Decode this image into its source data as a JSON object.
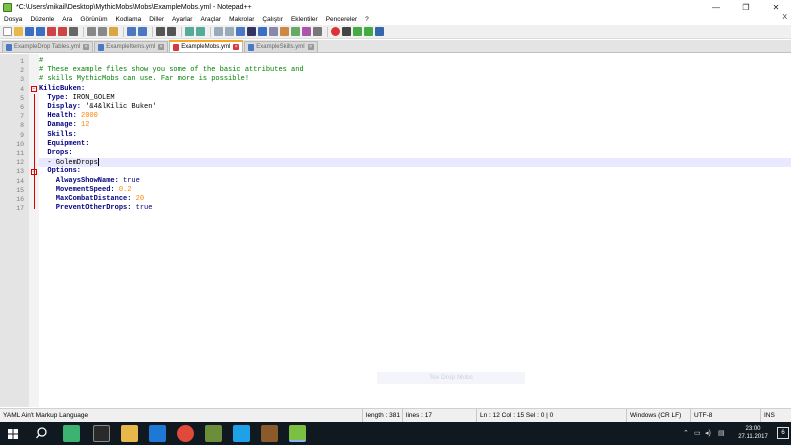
{
  "window": {
    "title": "*C:\\Users\\mikail\\Desktop\\MythicMobs\\Mobs\\ExampleMobs.yml - Notepad++",
    "minimize": "—",
    "maximize": "❐",
    "close": "✕"
  },
  "menu": {
    "items": [
      "Dosya",
      "Düzenle",
      "Ara",
      "Görünüm",
      "Kodlama",
      "Diller",
      "Ayarlar",
      "Araçlar",
      "Makrolar",
      "Çalıştır",
      "Eklentiler",
      "Pencereler",
      "?"
    ],
    "close_label": "X"
  },
  "tabs": [
    {
      "label": "ExampleDrop Tables.yml",
      "active": false
    },
    {
      "label": "ExampleItems.yml",
      "active": false
    },
    {
      "label": "ExampleMobs.yml",
      "active": true
    },
    {
      "label": "ExampleSkills.yml",
      "active": false
    }
  ],
  "editor": {
    "line_numbers": [
      "1",
      "2",
      "3",
      "4",
      "5",
      "6",
      "7",
      "8",
      "9",
      "10",
      "11",
      "12",
      "13",
      "14",
      "15",
      "16",
      "17"
    ],
    "lines": [
      [
        {
          "t": "#",
          "c": "comment"
        }
      ],
      [
        {
          "t": "# These example files show you some of the basic attributes and",
          "c": "comment"
        }
      ],
      [
        {
          "t": "# skills MythicMobs can use. Far more is possible!",
          "c": "comment"
        }
      ],
      [
        {
          "t": "KilicBuken:",
          "c": "key"
        }
      ],
      [
        {
          "t": "  Type: ",
          "c": "key"
        },
        {
          "t": "IRON_GOLEM",
          "c": "val"
        }
      ],
      [
        {
          "t": "  Display: ",
          "c": "key"
        },
        {
          "t": "'&4&lKilic Buken'",
          "c": "val"
        }
      ],
      [
        {
          "t": "  Health: ",
          "c": "key"
        },
        {
          "t": "2000",
          "c": "num"
        }
      ],
      [
        {
          "t": "  Damage: ",
          "c": "key"
        },
        {
          "t": "12",
          "c": "num"
        }
      ],
      [
        {
          "t": "  Skills:",
          "c": "key"
        }
      ],
      [
        {
          "t": "  Equipment:",
          "c": "key"
        }
      ],
      [
        {
          "t": "  Drops:",
          "c": "key"
        }
      ],
      [
        {
          "t": "  - GolemDrops",
          "c": "val"
        }
      ],
      [
        {
          "t": "  Options:",
          "c": "key"
        }
      ],
      [
        {
          "t": "    AlwaysShowName: ",
          "c": "key"
        },
        {
          "t": "true",
          "c": "bool"
        }
      ],
      [
        {
          "t": "    MovementSpeed: ",
          "c": "key"
        },
        {
          "t": "0.2",
          "c": "num"
        }
      ],
      [
        {
          "t": "    MaxCombatDistance: ",
          "c": "key"
        },
        {
          "t": "20",
          "c": "num"
        }
      ],
      [
        {
          "t": "    PreventOtherDrops: ",
          "c": "key"
        },
        {
          "t": "true",
          "c": "bool"
        }
      ]
    ],
    "current_line": 12,
    "ghost_text": "Tex Drop Mobs"
  },
  "status": {
    "language": "YAML Ain't Markup Language",
    "length": "length : 381",
    "lines": "lines : 17",
    "position": "Ln : 12    Col : 15    Sel : 0 | 0",
    "eol": "Windows (CR LF)",
    "encoding": "UTF-8",
    "mode": "INS"
  },
  "taskbar": {
    "time": "23:00",
    "date": "27.11.2017",
    "notifications": "6"
  },
  "colors": {
    "comment": "#008000",
    "key": "#000080",
    "number": "#ff8000",
    "active_tab_accent": "#f7a528"
  }
}
